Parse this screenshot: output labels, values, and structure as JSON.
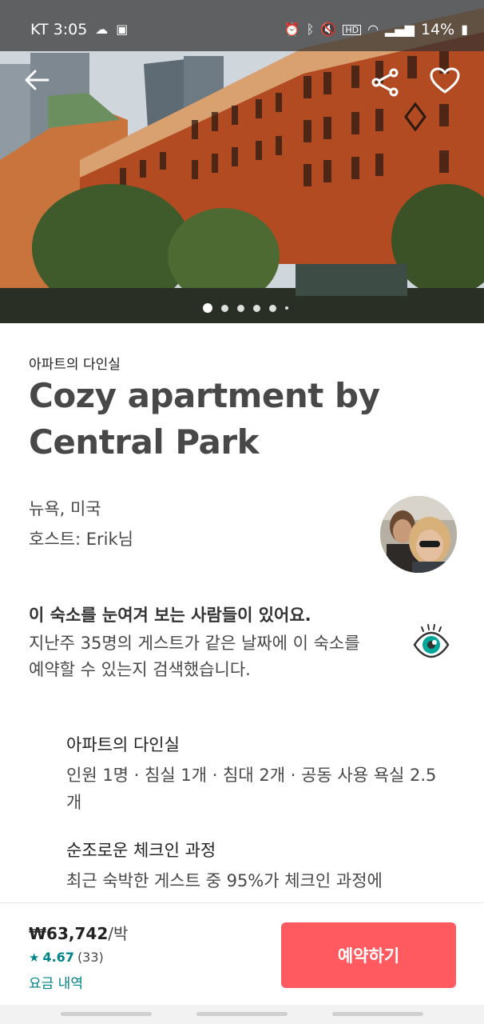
{
  "status_bar": {
    "carrier_time": "KT 3:05",
    "battery": "14%",
    "icons": [
      "cloud-icon",
      "photo-search-icon",
      "alarm-icon",
      "bluetooth-icon",
      "mute-icon",
      "hd-icon",
      "wifi-icon",
      "signal-icon",
      "battery-icon"
    ]
  },
  "hero": {
    "photo_pages": 6,
    "active_page": 1
  },
  "listing": {
    "category": "아파트의 다인실",
    "title": "Cozy apartment by Central Park",
    "location": "뉴욕, 미국",
    "host": "호스트: Erik님"
  },
  "notice": {
    "title": "이 숙소를 눈여겨 보는 사람들이 있어요.",
    "body": "지난주 35명의 게스트가 같은 날짜에 이 숙소를 예약할 수 있는지 검색했습니다."
  },
  "features": [
    {
      "title": "아파트의 다인실",
      "body": "인원 1명 · 침실 1개 · 침대 2개 · 공동 사용 욕실 2.5개"
    },
    {
      "title": "순조로운 체크인 과정",
      "body": "최근 숙박한 게스트 중 95%가 체크인 과정에"
    }
  ],
  "booking": {
    "price": "₩63,742",
    "per": "/박",
    "star": "★",
    "rating": "4.67",
    "review_count": "(33)",
    "price_details": "요금 내역",
    "reserve_label": "예약하기"
  },
  "colors": {
    "accent": "#FF5A5F",
    "teal": "#008489"
  }
}
